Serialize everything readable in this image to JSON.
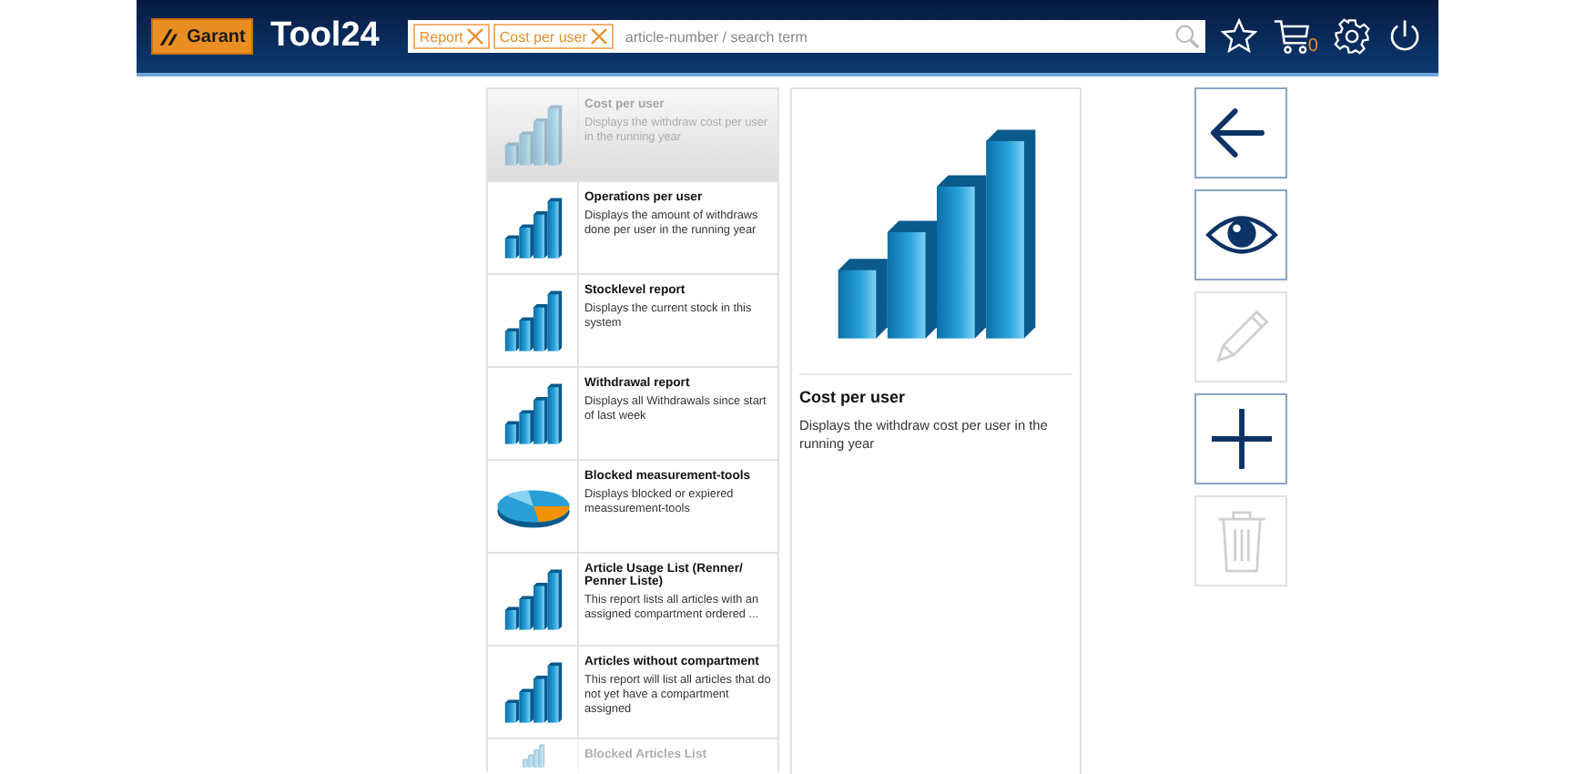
{
  "header": {
    "logo": "Garant",
    "app_title": "Tool24",
    "filters": [
      {
        "label": "Report"
      },
      {
        "label": "Cost per user"
      }
    ],
    "search": {
      "placeholder": "article-number / search term"
    },
    "cart_count": "0"
  },
  "reports": [
    {
      "title": "Cost per user",
      "description": "Displays the withdraw cost per user in the running year",
      "kind": "bar",
      "selected": true,
      "faded": true
    },
    {
      "title": "Operations per user",
      "description": "Displays the amount of withdraws done per user in the running year",
      "kind": "bar",
      "selected": false,
      "faded": false
    },
    {
      "title": "Stocklevel report",
      "description": "Displays the current stock in this system",
      "kind": "bar",
      "selected": false,
      "faded": false
    },
    {
      "title": "Withdrawal report",
      "description": "Displays all Withdrawals since start of last week",
      "kind": "bar",
      "selected": false,
      "faded": false
    },
    {
      "title": "Blocked measurement-tools",
      "description": "Displays blocked or expiered meassurement-tools",
      "kind": "pie",
      "selected": false,
      "faded": false
    },
    {
      "title": "Article Usage List (Renner/ Penner Liste)",
      "description": "This report lists all articles with an assigned compartment ordered ...",
      "kind": "bar",
      "selected": false,
      "faded": false
    },
    {
      "title": "Articles without compartment",
      "description": "This report will list all articles that do not yet have a compartment assigned",
      "kind": "bar",
      "selected": false,
      "faded": false
    },
    {
      "title": "Blocked Articles List",
      "kind": "bar",
      "selected": false,
      "faded": true
    }
  ],
  "detail": {
    "kind": "bar",
    "title": "Cost per user",
    "description": "Displays the withdraw cost per user in the running year"
  },
  "actions": [
    {
      "kind": "back",
      "disabled": false
    },
    {
      "kind": "view",
      "disabled": false
    },
    {
      "kind": "edit",
      "disabled": true
    },
    {
      "kind": "add",
      "disabled": false
    },
    {
      "kind": "delete",
      "disabled": true
    }
  ]
}
